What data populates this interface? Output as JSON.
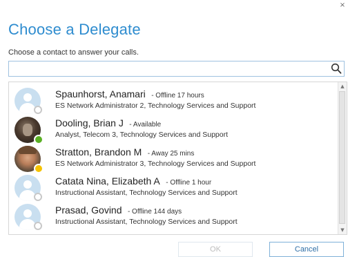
{
  "dialog": {
    "title": "Choose a Delegate",
    "instructions": "Choose a contact to answer your calls.",
    "close_glyph": "×"
  },
  "search": {
    "value": "",
    "placeholder": "",
    "icon": "search-icon"
  },
  "contacts": [
    {
      "name": "Spaunhorst, Anamari",
      "status": "- Offline 17 hours",
      "detail": "ES Network Administrator 2, Technology Services and Support",
      "presence": "offline",
      "avatar": "placeholder"
    },
    {
      "name": "Dooling, Brian J",
      "status": "- Available",
      "detail": "Analyst, Telecom 3, Technology Services and Support",
      "presence": "available",
      "avatar": "photo"
    },
    {
      "name": "Stratton, Brandon M",
      "status": "- Away 25 mins",
      "detail": "ES Network Administrator 3, Technology Services and Support",
      "presence": "away",
      "avatar": "photo"
    },
    {
      "name": "Catata Nina, Elizabeth A",
      "status": "- Offline 1 hour",
      "detail": "Instructional Assistant, Technology Services and Support",
      "presence": "offline",
      "avatar": "placeholder"
    },
    {
      "name": "Prasad, Govind",
      "status": "- Offline 144 days",
      "detail": "Instructional Assistant, Technology Services and Support",
      "presence": "offline",
      "avatar": "placeholder"
    }
  ],
  "buttons": {
    "ok": "OK",
    "cancel": "Cancel"
  },
  "colors": {
    "accent": "#2e8ccf",
    "available": "#5ab024",
    "away": "#f5c200",
    "offline": "#c8c8c8"
  }
}
